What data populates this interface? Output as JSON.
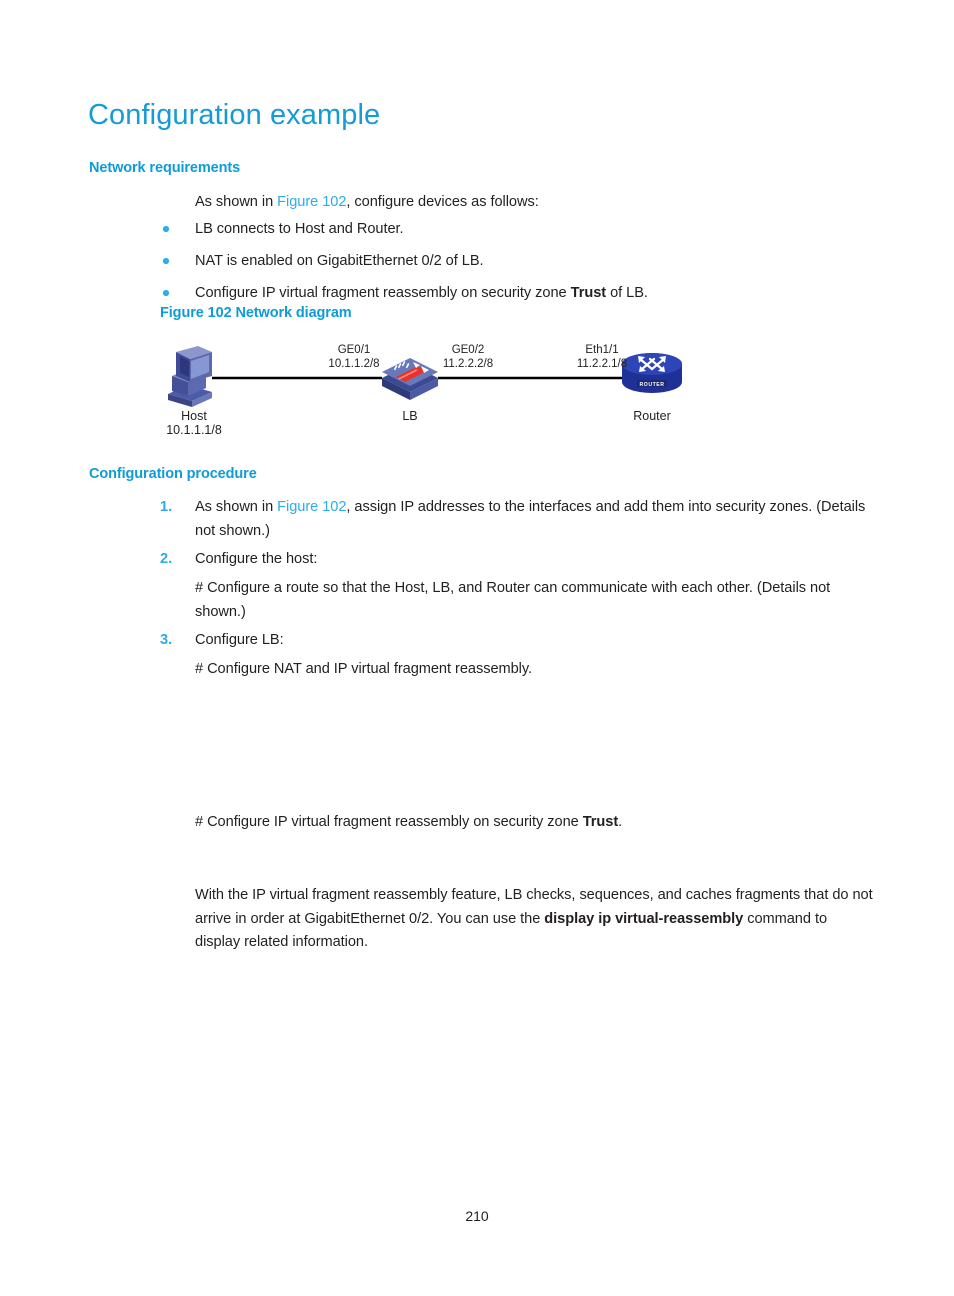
{
  "document": {
    "title": "Configuration example",
    "page_number": "210"
  },
  "colors": {
    "heading_blue": "#179bd7",
    "subheading_blue": "#0e9cd8",
    "link_blue": "#2badea",
    "body_text": "#231f20",
    "device_blue": "#4a5fa5",
    "device_blue_light": "#8490c4",
    "router_blue": "#2b3f9e",
    "accent_red": "#e8342a"
  },
  "sections": {
    "network_requirements": {
      "heading": "Network requirements",
      "intro_prefix": "As shown in ",
      "intro_link": "Figure 102",
      "intro_suffix": ", configure devices as follows:",
      "bullets": [
        {
          "text": "LB connects to Host and Router."
        },
        {
          "text": "NAT is enabled on GigabitEthernet 0/2 of LB."
        },
        {
          "pre": "Configure IP virtual fragment reassembly on security zone ",
          "bold": "Trust",
          "post": " of LB."
        }
      ]
    },
    "figure": {
      "caption": "Figure 102 Network diagram",
      "nodes": [
        {
          "id": "host",
          "label": "Host",
          "sublabel": "10.1.1.1/8",
          "icon": "desktop-computer-icon"
        },
        {
          "id": "lb",
          "label": "LB",
          "sublabel": "",
          "icon": "load-balancer-switch-icon"
        },
        {
          "id": "router",
          "label": "Router",
          "sublabel": "",
          "icon": "router-icon",
          "badge": "ROUTER"
        }
      ],
      "interfaces": [
        {
          "id": "ge0-1",
          "name": "GE0/1",
          "address": "10.1.1.2/8"
        },
        {
          "id": "ge0-2",
          "name": "GE0/2",
          "address": "11.2.2.2/8"
        },
        {
          "id": "eth1-1",
          "name": "Eth1/1",
          "address": "11.2.2.1/8"
        }
      ]
    },
    "configuration_procedure": {
      "heading": "Configuration procedure",
      "steps": [
        {
          "number": "1.",
          "pre": "As shown in ",
          "link": "Figure 102",
          "post": ", assign IP addresses to the interfaces and add them into security zones. (Details not shown.)"
        },
        {
          "number": "2.",
          "pre": "Configure the host:",
          "link": "",
          "post": "",
          "sub": "# Configure a route so that the Host, LB, and Router can communicate with each other. (Details not shown.)"
        },
        {
          "number": "3.",
          "pre": "Configure LB:",
          "link": "",
          "post": "",
          "sub": "# Configure NAT and IP virtual fragment reassembly."
        }
      ],
      "zone_line": {
        "pre": "# Configure IP virtual fragment reassembly on security zone ",
        "bold": "Trust",
        "post": "."
      },
      "closing_paragraph": {
        "pre": "With the IP virtual fragment reassembly feature, LB checks, sequences, and caches fragments that do not arrive in order at GigabitEthernet 0/2. You can use the ",
        "bold": "display ip virtual-reassembly",
        "post": " command to display related information."
      }
    }
  }
}
